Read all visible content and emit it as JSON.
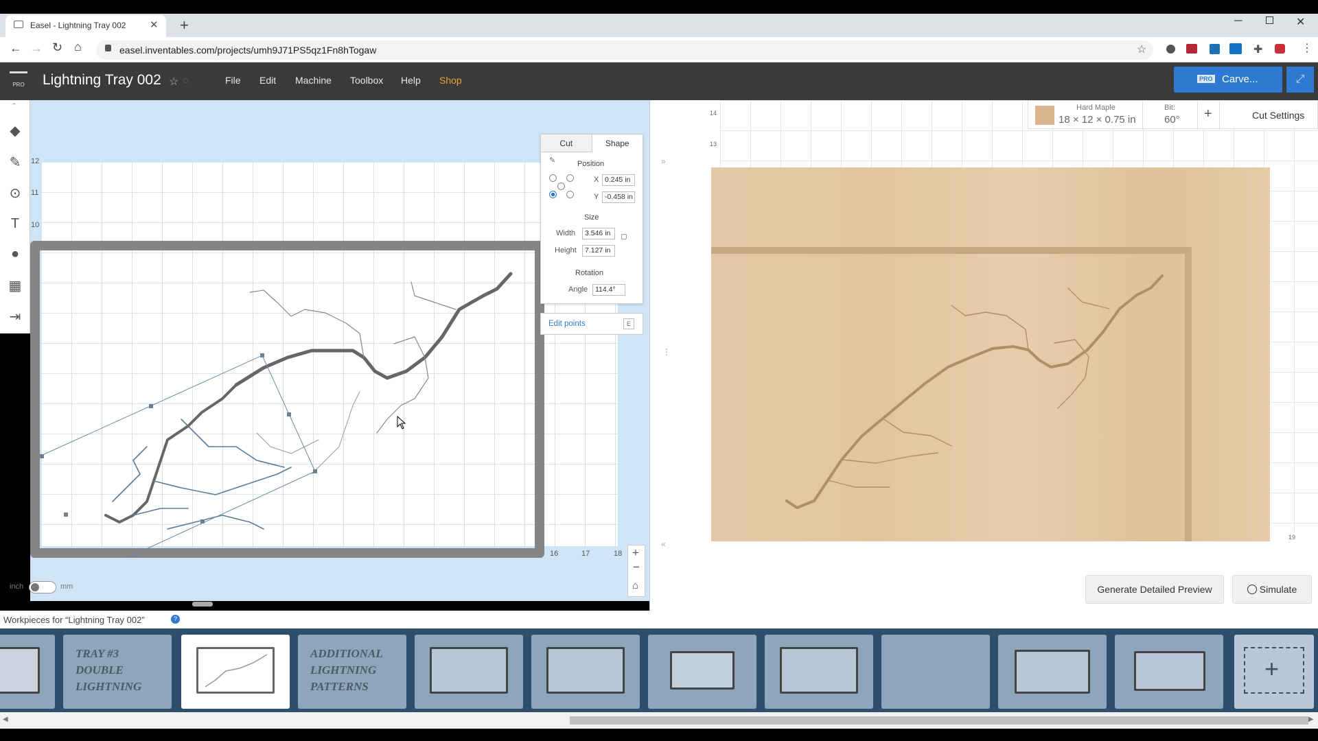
{
  "browser": {
    "tab_title": "Easel - Lightning Tray 002",
    "url": "easel.inventables.com/projects/umh9J71PS5qz1Fn8hTogaw"
  },
  "app": {
    "logo": "PRO",
    "project_title": "Lightning Tray 002",
    "menu": [
      "File",
      "Edit",
      "Machine",
      "Toolbox",
      "Help",
      "Shop"
    ],
    "shop_color": "#e8a23a",
    "carve_badge": "PRO",
    "carve_label": "Carve..."
  },
  "canvas": {
    "y_ticks": [
      "12",
      "11",
      "10"
    ],
    "x_ticks": [
      "16",
      "17",
      "18"
    ],
    "unit_left": "inch",
    "unit_right": "mm"
  },
  "shape_panel": {
    "tabs": [
      "Cut",
      "Shape"
    ],
    "position_label": "Position",
    "x_label": "X",
    "x_value": "0.245 in",
    "y_label": "Y",
    "y_value": "-0.458 in",
    "size_label": "Size",
    "width_label": "Width",
    "width_value": "3.546 in",
    "height_label": "Height",
    "height_value": "7.127 in",
    "rotation_label": "Rotation",
    "angle_label": "Angle",
    "angle_value": "114.4°",
    "edit_points": "Edit points",
    "edit_points_key": "E"
  },
  "preview": {
    "material_name": "Hard Maple",
    "material_size": "18 × 12 × 0.75 in",
    "bit_label": "Bit:",
    "bit_value": "60°",
    "add": "+",
    "cut_settings": "Cut Settings",
    "y_ticks": [
      "14",
      "13"
    ],
    "x_tick_right": "19",
    "generate_preview": "Generate Detailed Preview",
    "simulate": "Simulate"
  },
  "workpieces": {
    "header": "Workpieces for “Lightning Tray 002”",
    "items": [
      {
        "label": ""
      },
      {
        "label": "TRAY #3 DOUBLE LIGHTNING"
      },
      {
        "label": "",
        "selected": true
      },
      {
        "label": "ADDITIONAL LIGHTNING PATTERNS"
      },
      {
        "label": ""
      },
      {
        "label": ""
      },
      {
        "label": ""
      },
      {
        "label": ""
      },
      {
        "label": ""
      },
      {
        "label": ""
      },
      {
        "label": ""
      }
    ]
  }
}
